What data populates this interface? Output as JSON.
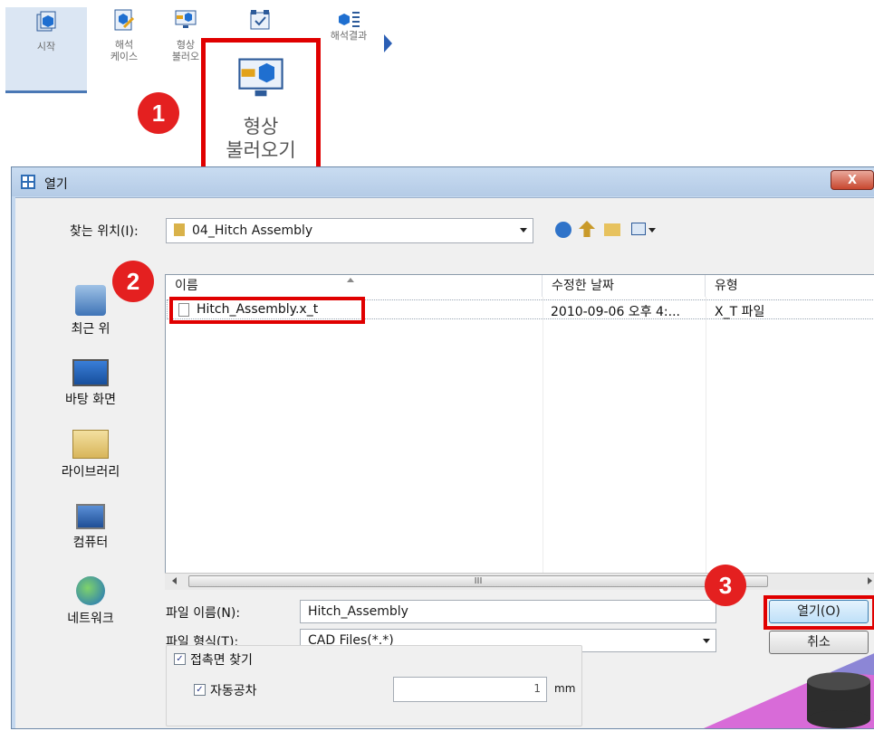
{
  "ribbon": {
    "items": [
      {
        "label_1": "시작",
        "label_2": ""
      },
      {
        "label_1": "해석",
        "label_2": "케이스"
      },
      {
        "label_1": "형상",
        "label_2": "불러오"
      },
      {
        "label_1": "",
        "label_2": ""
      },
      {
        "label_1": "해석결과",
        "label_2": ""
      }
    ]
  },
  "callout": {
    "line1": "형상",
    "line2": "불러오기"
  },
  "badges": [
    "1",
    "2",
    "3"
  ],
  "dialog": {
    "title": "열기",
    "close": "X",
    "lookin_label": "찾는 위치(I):",
    "lookin_value": "04_Hitch Assembly",
    "places": [
      "최근 위",
      "바탕 화면",
      "라이브러리",
      "컴퓨터",
      "네트워크"
    ],
    "columns": [
      "이름",
      "수정한 날짜",
      "유형"
    ],
    "rows": [
      {
        "name": "Hitch_Assembly.x_t",
        "date": "2010-09-06 오후 4:...",
        "type": "X_T 파일"
      }
    ],
    "scroll_mark": "III",
    "filename_label": "파일 이름(N):",
    "filename_value": "Hitch_Assembly",
    "filetype_label": "파일 형식(T):",
    "filetype_value": "CAD Files(*.*)",
    "open_button": "열기(O)",
    "cancel_button": "취소",
    "contact_label": "접촉면 찾기",
    "auto_label": "자동공차",
    "tolerance_value": "1",
    "tolerance_unit": "mm"
  },
  "colors": {
    "accent_red": "#e00000",
    "badge_red": "#e42020",
    "window_blue": "#c4d8ef"
  }
}
